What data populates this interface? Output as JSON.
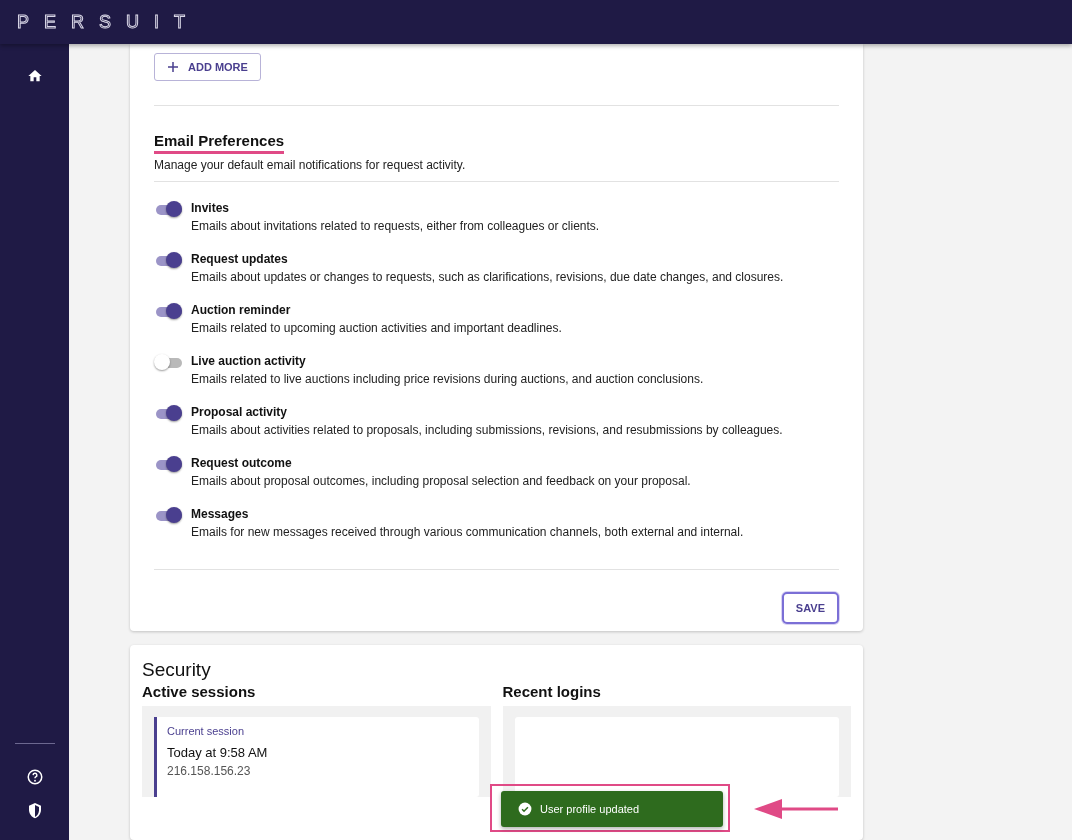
{
  "brand": "PERSUIT",
  "sidebar": {
    "items": [
      {
        "kind": "home"
      }
    ],
    "bottom_items": [
      {
        "kind": "help"
      },
      {
        "kind": "shield"
      }
    ]
  },
  "add_more": "ADD MORE",
  "email_preferences": {
    "title": "Email Preferences",
    "description": "Manage your default email notifications for request activity.",
    "items": [
      {
        "title": "Invites",
        "description": "Emails about invitations related to requests, either from colleagues or clients.",
        "on": true
      },
      {
        "title": "Request updates",
        "description": "Emails about updates or changes to requests, such as clarifications, revisions, due date changes, and closures.",
        "on": true
      },
      {
        "title": "Auction reminder",
        "description": "Emails related to upcoming auction activities and important deadlines.",
        "on": true
      },
      {
        "title": "Live auction activity",
        "description": "Emails related to live auctions including price revisions during auctions, and auction conclusions.",
        "on": false
      },
      {
        "title": "Proposal activity",
        "description": "Emails about activities related to proposals, including submissions, revisions, and resubmissions by colleagues.",
        "on": true
      },
      {
        "title": "Request outcome",
        "description": "Emails about proposal outcomes, including proposal selection and feedback on your proposal.",
        "on": true
      },
      {
        "title": "Messages",
        "description": "Emails for new messages received through various communication channels, both external and internal.",
        "on": true
      }
    ],
    "save": "SAVE"
  },
  "security": {
    "title": "Security",
    "active_sessions": {
      "title": "Active sessions",
      "sessions": [
        {
          "label": "Current session",
          "time": "Today at 9:58 AM",
          "ip": "216.158.156.23"
        }
      ]
    },
    "recent_logins": {
      "title": "Recent logins"
    }
  },
  "toast": {
    "message": "User profile updated"
  }
}
